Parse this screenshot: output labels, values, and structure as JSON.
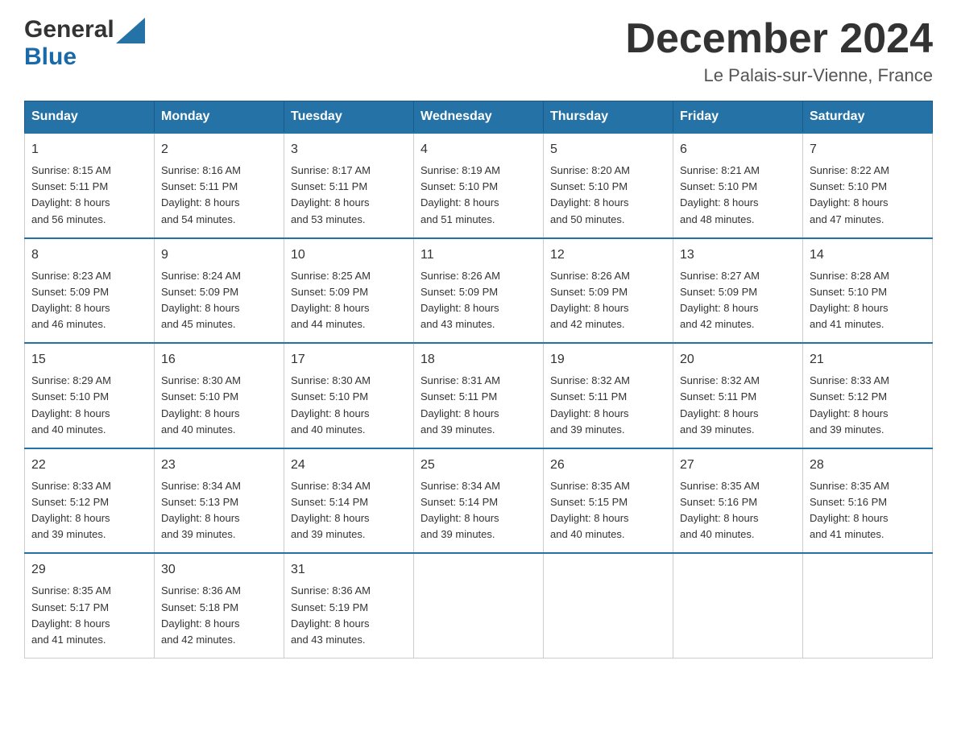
{
  "header": {
    "title": "December 2024",
    "subtitle": "Le Palais-sur-Vienne, France",
    "logo_general": "General",
    "logo_blue": "Blue"
  },
  "days_of_week": [
    "Sunday",
    "Monday",
    "Tuesday",
    "Wednesday",
    "Thursday",
    "Friday",
    "Saturday"
  ],
  "weeks": [
    [
      {
        "day": 1,
        "sunrise": "8:15 AM",
        "sunset": "5:11 PM",
        "daylight": "8 hours and 56 minutes."
      },
      {
        "day": 2,
        "sunrise": "8:16 AM",
        "sunset": "5:11 PM",
        "daylight": "8 hours and 54 minutes."
      },
      {
        "day": 3,
        "sunrise": "8:17 AM",
        "sunset": "5:11 PM",
        "daylight": "8 hours and 53 minutes."
      },
      {
        "day": 4,
        "sunrise": "8:19 AM",
        "sunset": "5:10 PM",
        "daylight": "8 hours and 51 minutes."
      },
      {
        "day": 5,
        "sunrise": "8:20 AM",
        "sunset": "5:10 PM",
        "daylight": "8 hours and 50 minutes."
      },
      {
        "day": 6,
        "sunrise": "8:21 AM",
        "sunset": "5:10 PM",
        "daylight": "8 hours and 48 minutes."
      },
      {
        "day": 7,
        "sunrise": "8:22 AM",
        "sunset": "5:10 PM",
        "daylight": "8 hours and 47 minutes."
      }
    ],
    [
      {
        "day": 8,
        "sunrise": "8:23 AM",
        "sunset": "5:09 PM",
        "daylight": "8 hours and 46 minutes."
      },
      {
        "day": 9,
        "sunrise": "8:24 AM",
        "sunset": "5:09 PM",
        "daylight": "8 hours and 45 minutes."
      },
      {
        "day": 10,
        "sunrise": "8:25 AM",
        "sunset": "5:09 PM",
        "daylight": "8 hours and 44 minutes."
      },
      {
        "day": 11,
        "sunrise": "8:26 AM",
        "sunset": "5:09 PM",
        "daylight": "8 hours and 43 minutes."
      },
      {
        "day": 12,
        "sunrise": "8:26 AM",
        "sunset": "5:09 PM",
        "daylight": "8 hours and 42 minutes."
      },
      {
        "day": 13,
        "sunrise": "8:27 AM",
        "sunset": "5:09 PM",
        "daylight": "8 hours and 42 minutes."
      },
      {
        "day": 14,
        "sunrise": "8:28 AM",
        "sunset": "5:10 PM",
        "daylight": "8 hours and 41 minutes."
      }
    ],
    [
      {
        "day": 15,
        "sunrise": "8:29 AM",
        "sunset": "5:10 PM",
        "daylight": "8 hours and 40 minutes."
      },
      {
        "day": 16,
        "sunrise": "8:30 AM",
        "sunset": "5:10 PM",
        "daylight": "8 hours and 40 minutes."
      },
      {
        "day": 17,
        "sunrise": "8:30 AM",
        "sunset": "5:10 PM",
        "daylight": "8 hours and 40 minutes."
      },
      {
        "day": 18,
        "sunrise": "8:31 AM",
        "sunset": "5:11 PM",
        "daylight": "8 hours and 39 minutes."
      },
      {
        "day": 19,
        "sunrise": "8:32 AM",
        "sunset": "5:11 PM",
        "daylight": "8 hours and 39 minutes."
      },
      {
        "day": 20,
        "sunrise": "8:32 AM",
        "sunset": "5:11 PM",
        "daylight": "8 hours and 39 minutes."
      },
      {
        "day": 21,
        "sunrise": "8:33 AM",
        "sunset": "5:12 PM",
        "daylight": "8 hours and 39 minutes."
      }
    ],
    [
      {
        "day": 22,
        "sunrise": "8:33 AM",
        "sunset": "5:12 PM",
        "daylight": "8 hours and 39 minutes."
      },
      {
        "day": 23,
        "sunrise": "8:34 AM",
        "sunset": "5:13 PM",
        "daylight": "8 hours and 39 minutes."
      },
      {
        "day": 24,
        "sunrise": "8:34 AM",
        "sunset": "5:14 PM",
        "daylight": "8 hours and 39 minutes."
      },
      {
        "day": 25,
        "sunrise": "8:34 AM",
        "sunset": "5:14 PM",
        "daylight": "8 hours and 39 minutes."
      },
      {
        "day": 26,
        "sunrise": "8:35 AM",
        "sunset": "5:15 PM",
        "daylight": "8 hours and 40 minutes."
      },
      {
        "day": 27,
        "sunrise": "8:35 AM",
        "sunset": "5:16 PM",
        "daylight": "8 hours and 40 minutes."
      },
      {
        "day": 28,
        "sunrise": "8:35 AM",
        "sunset": "5:16 PM",
        "daylight": "8 hours and 41 minutes."
      }
    ],
    [
      {
        "day": 29,
        "sunrise": "8:35 AM",
        "sunset": "5:17 PM",
        "daylight": "8 hours and 41 minutes."
      },
      {
        "day": 30,
        "sunrise": "8:36 AM",
        "sunset": "5:18 PM",
        "daylight": "8 hours and 42 minutes."
      },
      {
        "day": 31,
        "sunrise": "8:36 AM",
        "sunset": "5:19 PM",
        "daylight": "8 hours and 43 minutes."
      },
      null,
      null,
      null,
      null
    ]
  ],
  "labels": {
    "sunrise": "Sunrise:",
    "sunset": "Sunset:",
    "daylight": "Daylight:"
  }
}
